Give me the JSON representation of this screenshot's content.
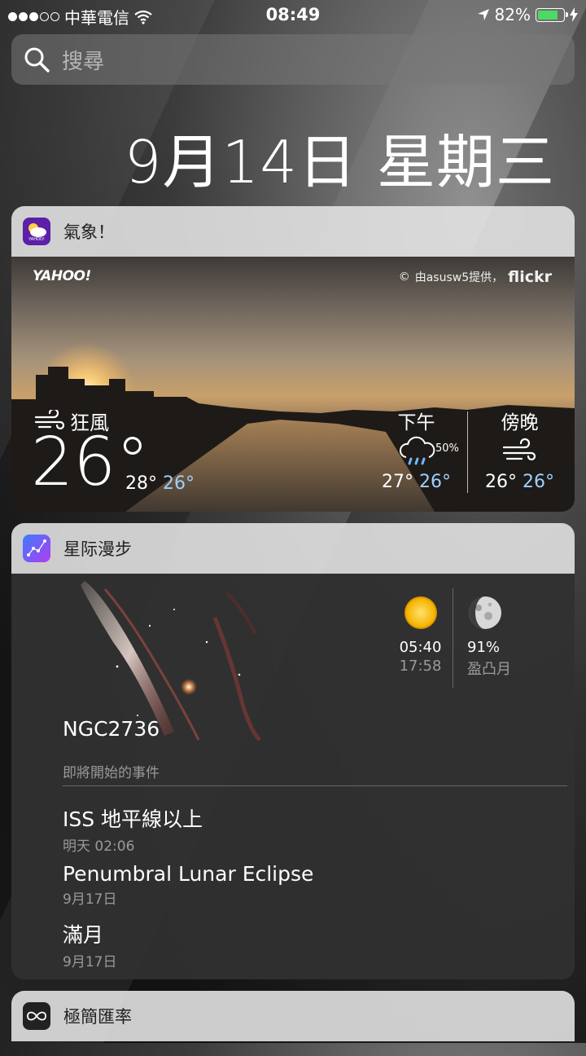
{
  "status_bar": {
    "carrier": "中華電信",
    "time": "08:49",
    "battery_percent_text": "82%",
    "battery_level": 0.82,
    "signal_bars_filled": 3,
    "signal_bars_total": 5
  },
  "search": {
    "placeholder": "搜尋"
  },
  "date_header": "9月14日 星期三",
  "weather_widget": {
    "app_name": "氣象！",
    "photo_brand": "YAHOO!",
    "photo_credit": "由asusw5提供，",
    "photo_source": "flickr",
    "current": {
      "condition": "狂風",
      "temp": "26°",
      "high": "28°",
      "low": "26°"
    },
    "forecasts": [
      {
        "label": "下午",
        "precip": "50%",
        "high": "27°",
        "low": "26°",
        "icon": "rain-cloud-icon"
      },
      {
        "label": "傍晚",
        "high": "26°",
        "low": "26°",
        "icon": "wind-icon"
      }
    ]
  },
  "sky_widget": {
    "app_name": "星际漫步",
    "object_name": "NGC2736",
    "sun": {
      "rise": "05:40",
      "set": "17:58"
    },
    "moon": {
      "illumination": "91%",
      "phase": "盈凸月"
    },
    "events_header": "即將開始的事件",
    "events": [
      {
        "name": "ISS 地平線以上",
        "when": "明天 02:06"
      },
      {
        "name": "Penumbral Lunar Eclipse",
        "when": "9月17日"
      },
      {
        "name": "滿月",
        "when": "9月17日"
      }
    ]
  },
  "rate_widget": {
    "app_name": "極簡匯率"
  },
  "colors": {
    "lo_temp": "#9fd0ff",
    "battery": "#4cd964",
    "weather_icon_bg": "#5b1fa8",
    "sky_icon_bg": "#7a3cf0"
  }
}
